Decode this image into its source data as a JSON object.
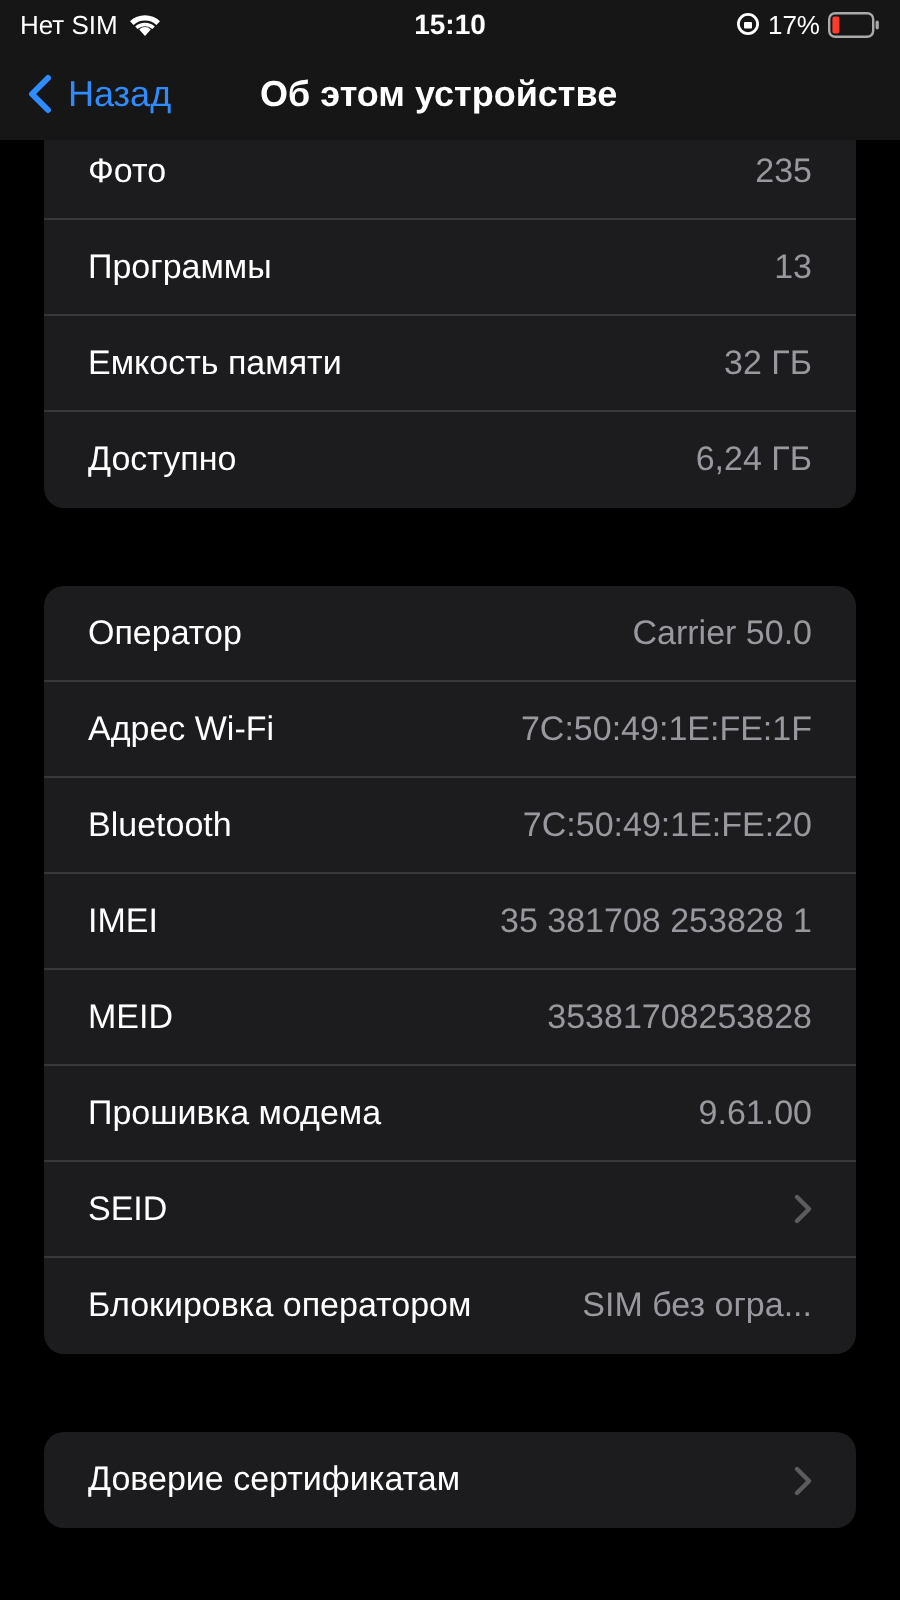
{
  "status_bar": {
    "carrier": "Нет SIM",
    "time": "15:10",
    "battery": "17%"
  },
  "nav": {
    "back": "Назад",
    "title": "Об этом устройстве"
  },
  "groups": [
    {
      "rows": [
        {
          "kind": "value",
          "label": "Фото",
          "value": "235"
        },
        {
          "kind": "value",
          "label": "Программы",
          "value": "13"
        },
        {
          "kind": "value",
          "label": "Емкость памяти",
          "value": "32 ГБ"
        },
        {
          "kind": "value",
          "label": "Доступно",
          "value": "6,24 ГБ"
        }
      ]
    },
    {
      "rows": [
        {
          "kind": "value",
          "label": "Оператор",
          "value": "Carrier 50.0"
        },
        {
          "kind": "value",
          "label": "Адрес Wi-Fi",
          "value": "7C:50:49:1E:FE:1F"
        },
        {
          "kind": "value",
          "label": "Bluetooth",
          "value": "7C:50:49:1E:FE:20"
        },
        {
          "kind": "value",
          "label": "IMEI",
          "value": "35 381708 253828 1"
        },
        {
          "kind": "value",
          "label": "MEID",
          "value": "35381708253828"
        },
        {
          "kind": "value",
          "label": "Прошивка модема",
          "value": "9.61.00"
        },
        {
          "kind": "link",
          "label": "SEID"
        },
        {
          "kind": "value",
          "label": "Блокировка оператором",
          "value": "SIM без огра..."
        }
      ]
    },
    {
      "rows": [
        {
          "kind": "link",
          "label": "Доверие сертификатам"
        }
      ]
    }
  ]
}
